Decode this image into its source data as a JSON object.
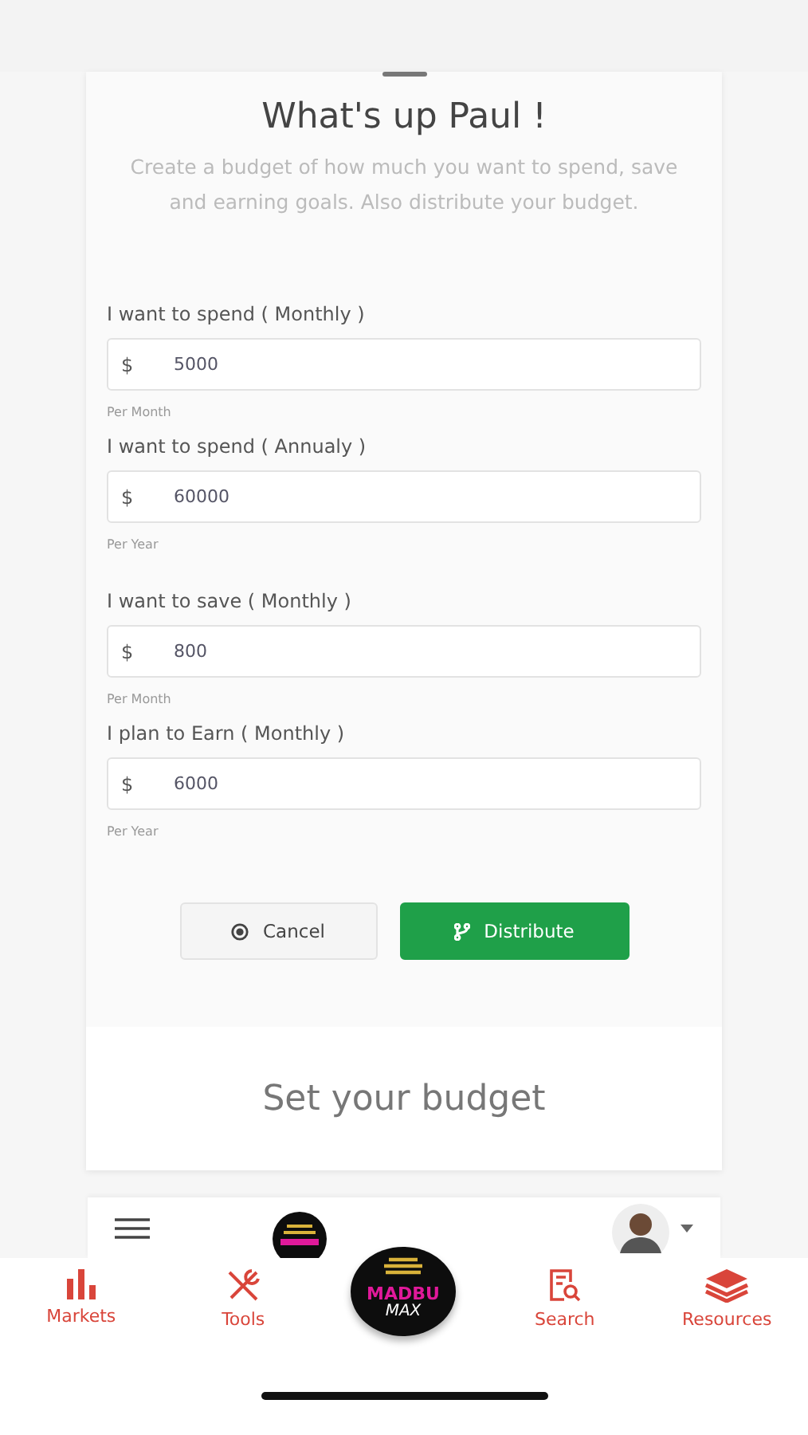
{
  "card": {
    "title": "What's up Paul !",
    "subtitle": "Create a budget of how much you want to spend, save and earning goals. Also distribute your budget.",
    "fields": [
      {
        "label": "I want to spend ( Monthly )",
        "currency": "$",
        "value": "5000",
        "hint": "Per Month"
      },
      {
        "label": "I want to spend ( Annualy )",
        "currency": "$",
        "value": "60000",
        "hint": "Per Year"
      },
      {
        "label": "I want to save ( Monthly )",
        "currency": "$",
        "value": "800",
        "hint": "Per Month"
      },
      {
        "label": "I plan to Earn ( Monthly )",
        "currency": "$",
        "value": "6000",
        "hint": "Per Year"
      }
    ],
    "buttons": [
      {
        "label": "Cancel",
        "kind": "secondary"
      },
      {
        "label": "Distribute",
        "kind": "primary"
      }
    ],
    "footer": "Set your budget"
  },
  "logo": {
    "top": "MADBU",
    "bottom": "MAX"
  },
  "tab_bar": [
    {
      "label": "Markets",
      "kind": "chart"
    },
    {
      "label": "Tools",
      "kind": "tools"
    },
    {
      "label": "Search",
      "kind": "search"
    },
    {
      "label": "Resources",
      "kind": "layers"
    }
  ]
}
